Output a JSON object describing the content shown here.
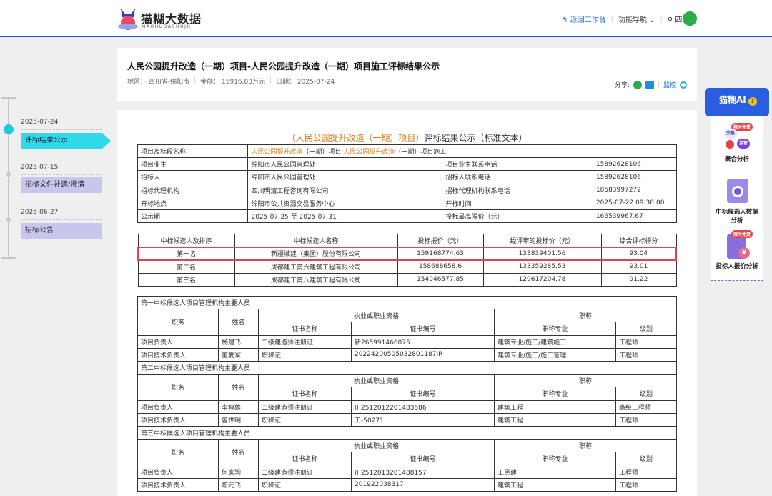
{
  "header": {
    "logo_text": "猫糊大数据",
    "logo_sub": "MAOHUDASHUJU",
    "back_label": "返回工作台",
    "nav_label": "功能导航",
    "region_label": "四川"
  },
  "project": {
    "title": "人民公园提升改造（一期）项目-人民公园提升改造（一期）项目施工评标结果公示",
    "region": "地区： 四川省-绵阳市",
    "amount": "金额： 15916.88万元",
    "date": "日期： 2025-07-24",
    "share_label": "分享:",
    "monitor_label": "监控"
  },
  "timeline": [
    {
      "date": "2025-07-24",
      "label": "评标结果公示",
      "active": true
    },
    {
      "date": "2025-07-15",
      "label": "招标文件补遗/澄清",
      "active": false
    },
    {
      "date": "2025-06-27",
      "label": "招标公告",
      "active": false
    }
  ],
  "doc": {
    "title_hl": "（人民公园提升改造（一期）项目）",
    "title_rest": "评标结果公示（标准文本）",
    "info": {
      "section_label": "项目及标段名称",
      "section_val_a": "人民公园提升改造",
      "section_val_b": "（一期）项目",
      "section_val_c": "人民公园提升改造",
      "section_val_d": "（一期）项目施工",
      "owner_label": "项目业主",
      "owner": "绵阳市人民公园管理处",
      "owner_phone_label": "项目业主联系电话",
      "owner_phone": "15892628106",
      "tenderer_label": "招标人",
      "tenderer": "绵阳市人民公园管理处",
      "tenderer_phone_label": "招标人联系电话",
      "tenderer_phone": "15892628106",
      "agent_label": "招标代理机构",
      "agent": "四川明清工程咨询有限公司",
      "agent_phone_label": "招标代理机构联系电话",
      "agent_phone": "18583997272",
      "place_label": "开标地点",
      "place": "绵阳市公共资源交易服务中心",
      "time_label": "开标时间",
      "time": "2025-07-22 09:30:00",
      "period_label": "公示期",
      "period": "2025-07-25 至 2025-07-31",
      "maxprice_label": "投标最高限价（元）",
      "maxprice": "166539967.67"
    },
    "candidates": {
      "headers": [
        "中标候选人及排序",
        "中标候选人名称",
        "投标报价（元）",
        "经评审的投标价（元）",
        "综合评标得分"
      ],
      "rows": [
        [
          "第一名",
          "新疆城建（集团）股份有限公司",
          "159168774.63",
          "133839401.56",
          "93.04"
        ],
        [
          "第二名",
          "成都建工第六建筑工程有限公司",
          "158688658.6",
          "133359285.53",
          "93.01"
        ],
        [
          "第三名",
          "成都建工第八建筑工程有限公司",
          "154946577.85",
          "129617204.78",
          "91.22"
        ]
      ]
    },
    "staff": {
      "position": "职务",
      "name": "姓名",
      "qualification": "执业或职业资格",
      "title": "职称",
      "cert_name": "证书名称",
      "cert_no": "证书编号",
      "specialty": "职称专业",
      "level": "级别",
      "groups": [
        {
          "heading": "第一中标候选人项目管理机构主要人员",
          "rows": [
            [
              "项目负责人",
              "杨建飞",
              "二级建造师注册证",
              "新265991466075",
              "建筑专业/施工/建筑施工",
              "工程师"
            ],
            [
              "项目技术负责人",
              "董爱军",
              "职称证",
              "20224200505032801187IR",
              "建筑专业/施工/施工管理",
              "工程师"
            ]
          ]
        },
        {
          "heading": "第二中标候选人项目管理机构主要人员",
          "rows": [
            [
              "项目负责人",
              "李智雄",
              "二级建造师注册证",
              "川2512012201483586",
              "建筑工程",
              "高级工程师"
            ],
            [
              "项目技术负责人",
              "曾世明",
              "职称证",
              "工-50271",
              "建筑工程",
              "工程师"
            ]
          ]
        },
        {
          "heading": "第三中标候选人项目管理机构主要人员",
          "rows": [
            [
              "项目负责人",
              "何家驹",
              "二级建造师注册证",
              "川2512013201488157",
              "工民建",
              "工程师"
            ],
            [
              "项目技术负责人",
              "陈元飞",
              "职称证",
              "201922038317",
              "建筑工程",
              "工程师"
            ]
          ]
        }
      ]
    }
  },
  "ai": {
    "title": "猫糊AI",
    "tiles": [
      {
        "label": "聚合分析",
        "badge": "限时免费",
        "chips": [
          "交易",
          "监管"
        ]
      },
      {
        "label": "中标候选人数据分析",
        "badge": ""
      },
      {
        "label": "投标人报价分析",
        "badge": "限时免费"
      }
    ]
  },
  "colors": {
    "accent": "#1f4fd8",
    "timeline_active": "#2fdbe8",
    "timeline_item": "#c9c6ee",
    "highlight": "#e0454b",
    "orange": "#d87f1f"
  }
}
